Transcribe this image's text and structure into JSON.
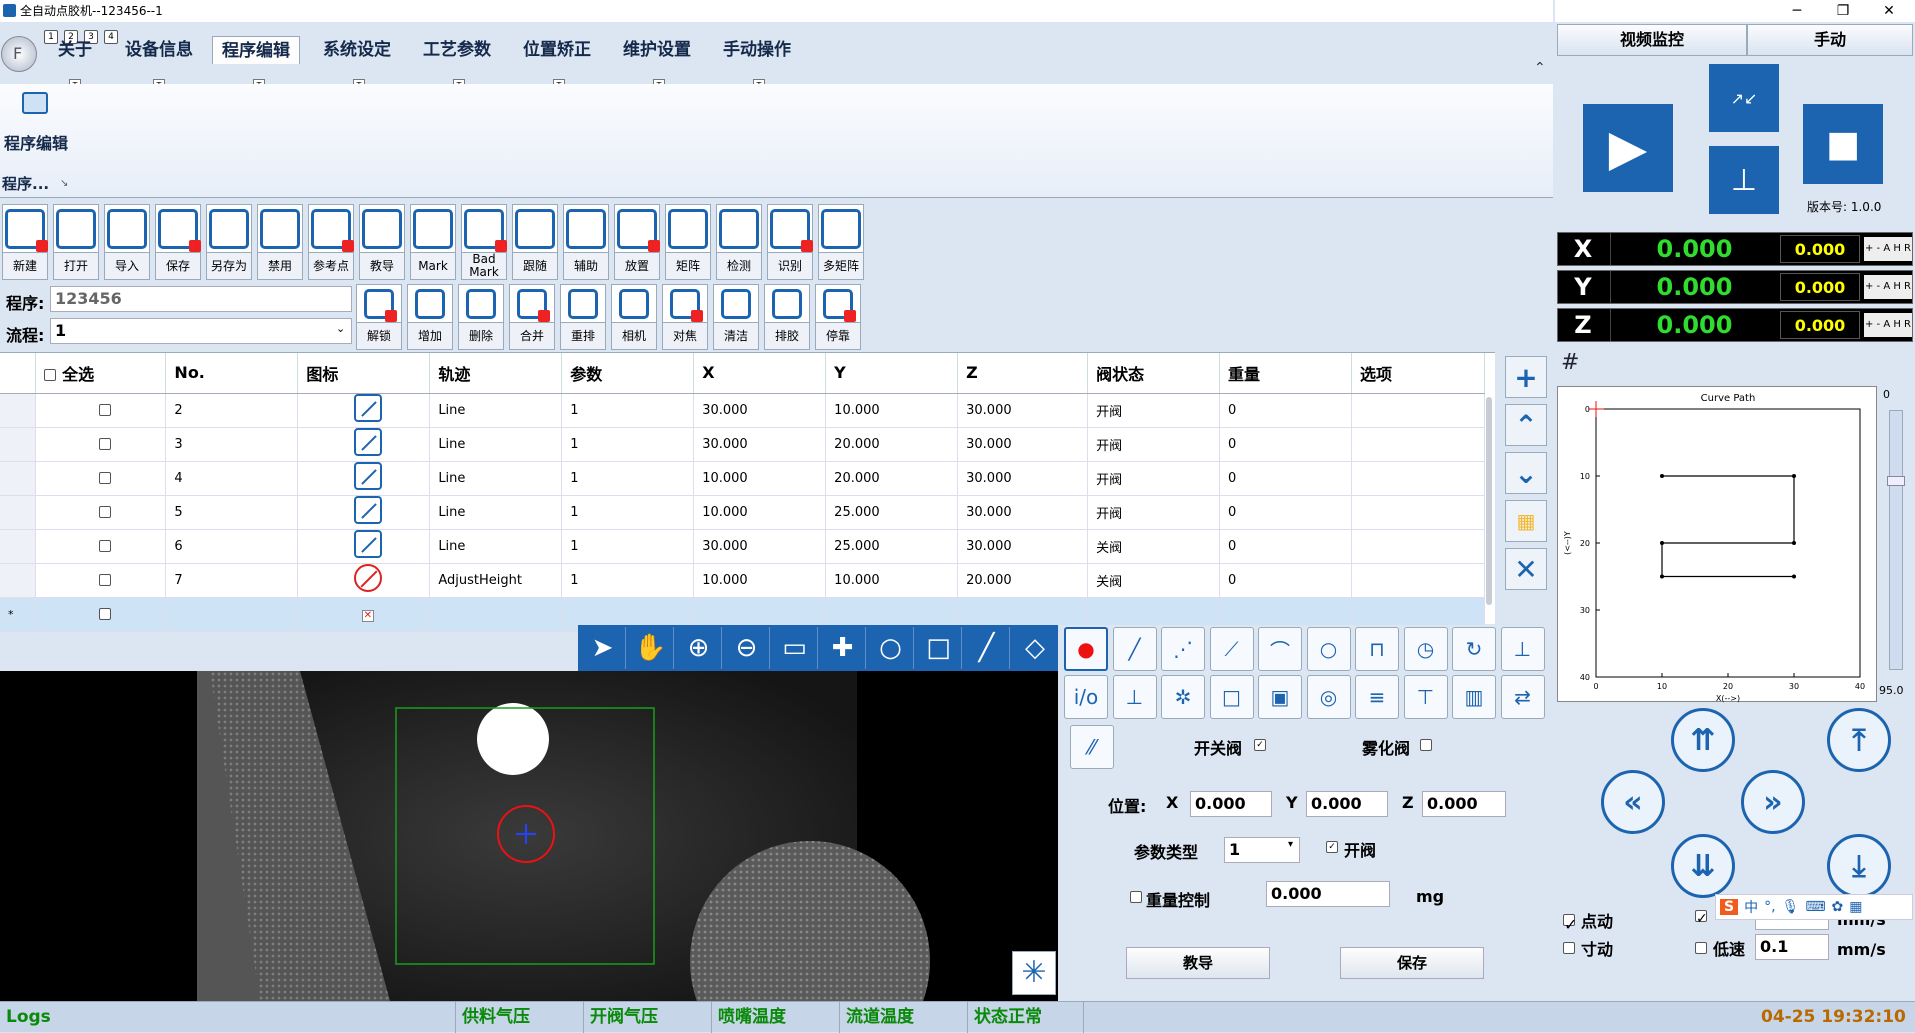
{
  "window": {
    "title": "全自动点胶机--123456--1"
  },
  "quick_access": [
    "1",
    "2",
    "3",
    "4"
  ],
  "ribbon": {
    "tabs": [
      "关于",
      "设备信息",
      "程序编辑",
      "系统设定",
      "工艺参数",
      "位置矫正",
      "维护设置",
      "手动操作"
    ],
    "active_tab": "程序编辑",
    "keytip": "T",
    "group_button": "程序编辑",
    "group_label": "程序..."
  },
  "toolbar": {
    "row1": [
      "新建",
      "打开",
      "导入",
      "保存",
      "另存为",
      "禁用",
      "参考点",
      "教导",
      "Mark",
      "Bad Mark",
      "跟随",
      "辅助",
      "放置",
      "矩阵",
      "检测",
      "识别",
      "多矩阵"
    ],
    "row2": [
      "解锁",
      "增加",
      "删除",
      "合并",
      "重排",
      "相机",
      "对焦",
      "清洁",
      "排胶",
      "停靠"
    ],
    "program_label": "程序:",
    "program_value": "123456",
    "flow_label": "流程:",
    "flow_value": "1"
  },
  "grid": {
    "headers": [
      "全选",
      "No.",
      "图标",
      "轨迹",
      "参数",
      "X",
      "Y",
      "Z",
      "阀状态",
      "重量",
      "选项"
    ],
    "rows": [
      {
        "no": "2",
        "icon": "line-icon",
        "track": "Line",
        "param": "1",
        "x": "30.000",
        "y": "10.000",
        "z": "30.000",
        "valve": "开阀",
        "weight": "0"
      },
      {
        "no": "3",
        "icon": "line-icon",
        "track": "Line",
        "param": "1",
        "x": "30.000",
        "y": "20.000",
        "z": "30.000",
        "valve": "开阀",
        "weight": "0"
      },
      {
        "no": "4",
        "icon": "line-icon",
        "track": "Line",
        "param": "1",
        "x": "10.000",
        "y": "20.000",
        "z": "30.000",
        "valve": "开阀",
        "weight": "0"
      },
      {
        "no": "5",
        "icon": "line-icon",
        "track": "Line",
        "param": "1",
        "x": "10.000",
        "y": "25.000",
        "z": "30.000",
        "valve": "开阀",
        "weight": "0"
      },
      {
        "no": "6",
        "icon": "line-icon",
        "track": "Line",
        "param": "1",
        "x": "30.000",
        "y": "25.000",
        "z": "30.000",
        "valve": "关阀",
        "weight": "0"
      },
      {
        "no": "7",
        "icon": "adjust-height-icon",
        "track": "AdjustHeight",
        "param": "1",
        "x": "10.000",
        "y": "10.000",
        "z": "20.000",
        "valve": "关阀",
        "weight": "0"
      }
    ],
    "new_row_marker": "*"
  },
  "path_panel": {
    "switch_valve_label": "开关阀",
    "atomize_valve_label": "雾化阀",
    "position_label": "位置:",
    "x_label": "X",
    "x_value": "0.000",
    "y_label": "Y",
    "y_value": "0.000",
    "z_label": "Z",
    "z_value": "0.000",
    "param_type_label": "参数类型",
    "param_type_value": "1",
    "open_valve_label": "开阀",
    "weight_ctrl_label": "重量控制",
    "weight_value": "0.000",
    "weight_unit": "mg",
    "teach_btn": "教导",
    "save_btn": "保存"
  },
  "status": {
    "logs": "Logs",
    "items": [
      "供料气压",
      "开阀气压",
      "喷嘴温度",
      "流道温度",
      "状态正常"
    ],
    "item_color": "#0a8a0a",
    "datetime": "04-25 19:32:10",
    "datetime_color": "#b86a00"
  },
  "right": {
    "tabs": [
      "视频监控",
      "手动"
    ],
    "version": "版本号: 1.0.0",
    "axes": [
      {
        "name": "X",
        "value": "0.000",
        "sub": "0.000",
        "mode": "+ - A H R"
      },
      {
        "name": "Y",
        "value": "0.000",
        "sub": "0.000",
        "mode": "+ - A H R"
      },
      {
        "name": "Z",
        "value": "0.000",
        "sub": "0.000",
        "mode": "+ - A H R"
      }
    ],
    "chart_title": "Curve Path",
    "chart_xlabel": "X(-->)",
    "chart_ylabel": "(<--)Y",
    "slider_top": "0",
    "slider_bottom": "95.0",
    "jog_label": "点动",
    "inch_label": "寸动",
    "low_speed_label": "低速",
    "speed_value": "0.1",
    "speed_unit": "mm/s",
    "speed_unit2": "mm/s",
    "ime_label": "中"
  },
  "chart_data": {
    "type": "line",
    "title": "Curve Path",
    "xlabel": "X(-->)",
    "ylabel": "(<--)Y",
    "xlim": [
      0,
      40
    ],
    "ylim": [
      0,
      40
    ],
    "xticks": [
      "0",
      "10",
      "20",
      "30",
      "40"
    ],
    "yticks": [
      "0",
      "10",
      "20",
      "30",
      "40"
    ],
    "x": [
      10,
      30,
      30,
      10,
      10,
      30
    ],
    "y": [
      10,
      10,
      20,
      20,
      25,
      25
    ]
  },
  "colors": {
    "accent": "#1d64b0",
    "bg": "#dce6f2"
  }
}
